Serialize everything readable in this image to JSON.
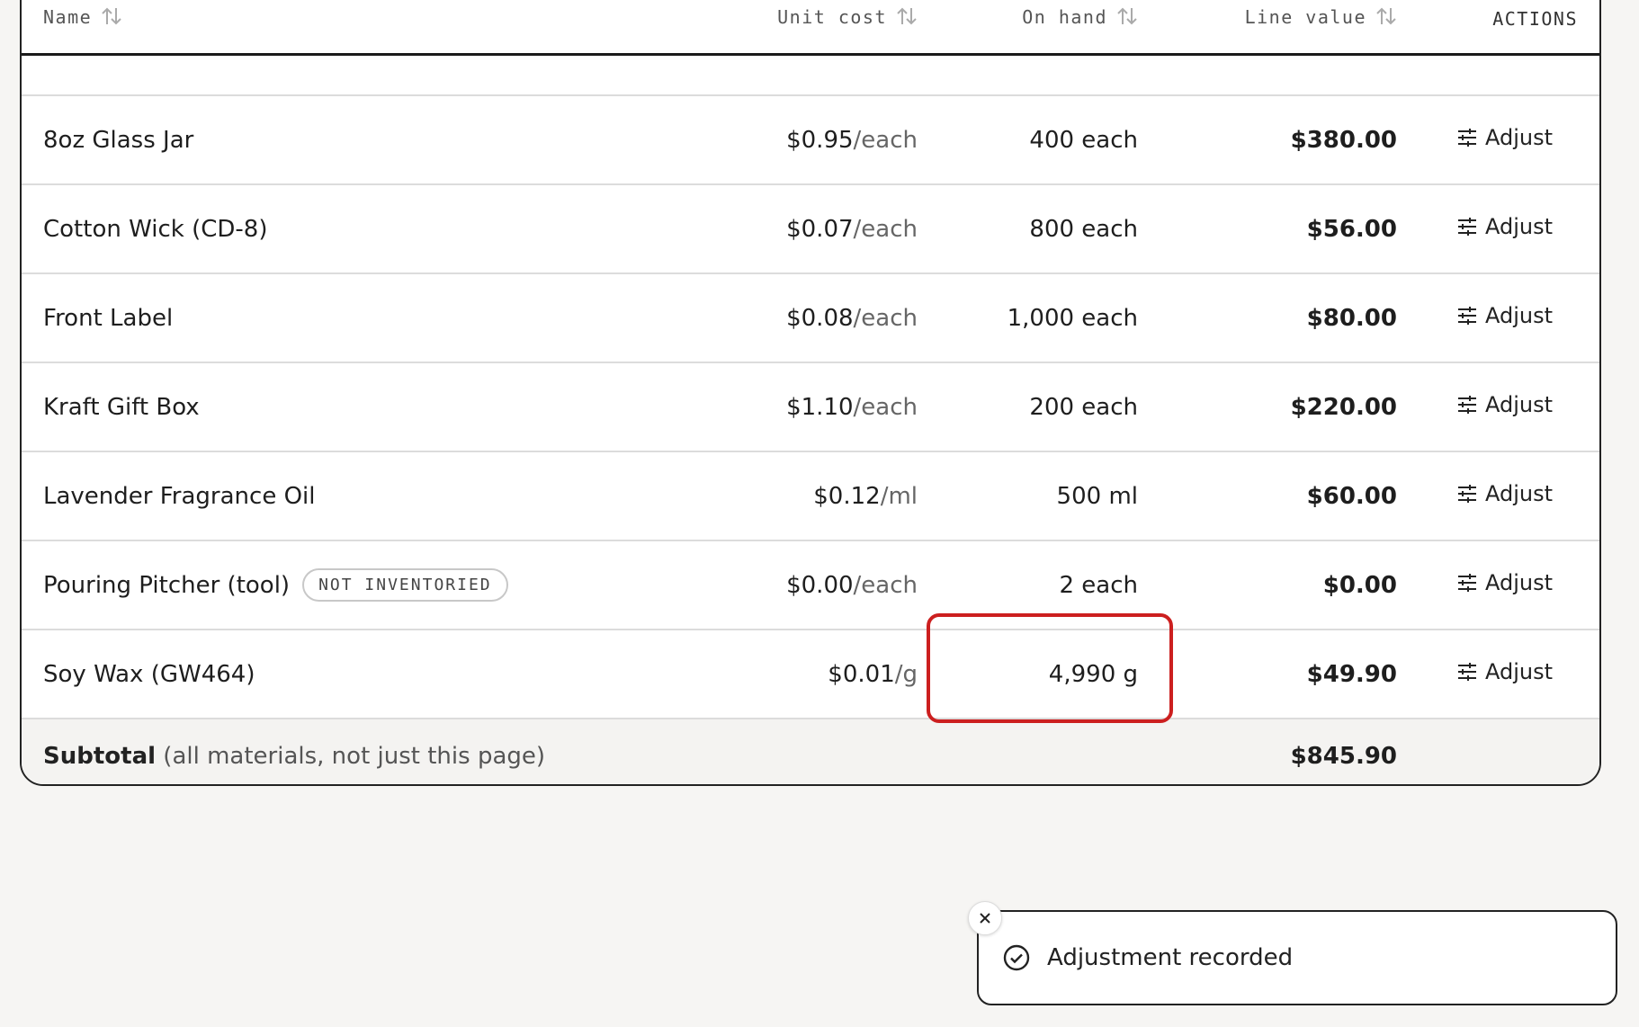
{
  "table": {
    "headers": {
      "name": "Name",
      "unit_cost": "Unit cost",
      "on_hand": "On hand",
      "line_value": "Line value",
      "actions": "ACTIONS"
    },
    "rows": [
      {
        "name": "8oz Glass Jar",
        "badge": "",
        "cost": "$0.95",
        "unit": "/each",
        "on_hand": "400 each",
        "line_value": "$380.00",
        "action": "Adjust"
      },
      {
        "name": "Cotton Wick (CD-8)",
        "badge": "",
        "cost": "$0.07",
        "unit": "/each",
        "on_hand": "800 each",
        "line_value": "$56.00",
        "action": "Adjust"
      },
      {
        "name": "Front Label",
        "badge": "",
        "cost": "$0.08",
        "unit": "/each",
        "on_hand": "1,000 each",
        "line_value": "$80.00",
        "action": "Adjust"
      },
      {
        "name": "Kraft Gift Box",
        "badge": "",
        "cost": "$1.10",
        "unit": "/each",
        "on_hand": "200 each",
        "line_value": "$220.00",
        "action": "Adjust"
      },
      {
        "name": "Lavender Fragrance Oil",
        "badge": "",
        "cost": "$0.12",
        "unit": "/ml",
        "on_hand": "500 ml",
        "line_value": "$60.00",
        "action": "Adjust"
      },
      {
        "name": "Pouring Pitcher (tool)",
        "badge": "NOT INVENTORIED",
        "cost": "$0.00",
        "unit": "/each",
        "on_hand": "2 each",
        "line_value": "$0.00",
        "action": "Adjust"
      },
      {
        "name": "Soy Wax (GW464)",
        "badge": "",
        "cost": "$0.01",
        "unit": "/g",
        "on_hand": "4,990 g",
        "line_value": "$49.90",
        "action": "Adjust"
      }
    ],
    "subtotal": {
      "label": "Subtotal",
      "note": "(all materials, not just this page)",
      "value": "$845.90"
    }
  },
  "toast": {
    "message": "Adjustment recorded",
    "icon": "check-circle-icon"
  },
  "colors": {
    "highlight": "#cc1f1f",
    "background": "#f6f5f3"
  }
}
